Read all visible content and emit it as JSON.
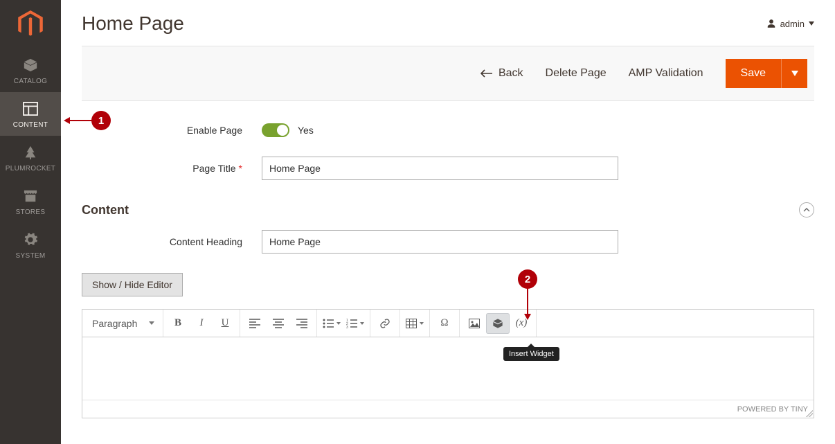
{
  "sidebar": {
    "items": [
      {
        "label": "CATALOG"
      },
      {
        "label": "CONTENT"
      },
      {
        "label": "PLUMROCKET"
      },
      {
        "label": "STORES"
      },
      {
        "label": "SYSTEM"
      }
    ]
  },
  "header": {
    "page_title": "Home Page",
    "user": "admin"
  },
  "actions": {
    "back": "Back",
    "delete": "Delete Page",
    "amp": "AMP Validation",
    "save": "Save"
  },
  "form": {
    "enable_page_label": "Enable Page",
    "enable_page_value": "Yes",
    "page_title_label": "Page Title",
    "page_title_value": "Home Page",
    "section_title": "Content",
    "content_heading_label": "Content Heading",
    "content_heading_value": "Home Page"
  },
  "editor": {
    "toggle_button": "Show / Hide Editor",
    "paragraph_label": "Paragraph",
    "tooltip": "Insert Widget",
    "footer": "POWERED BY TINY"
  },
  "callouts": {
    "c1": "1",
    "c2": "2"
  }
}
